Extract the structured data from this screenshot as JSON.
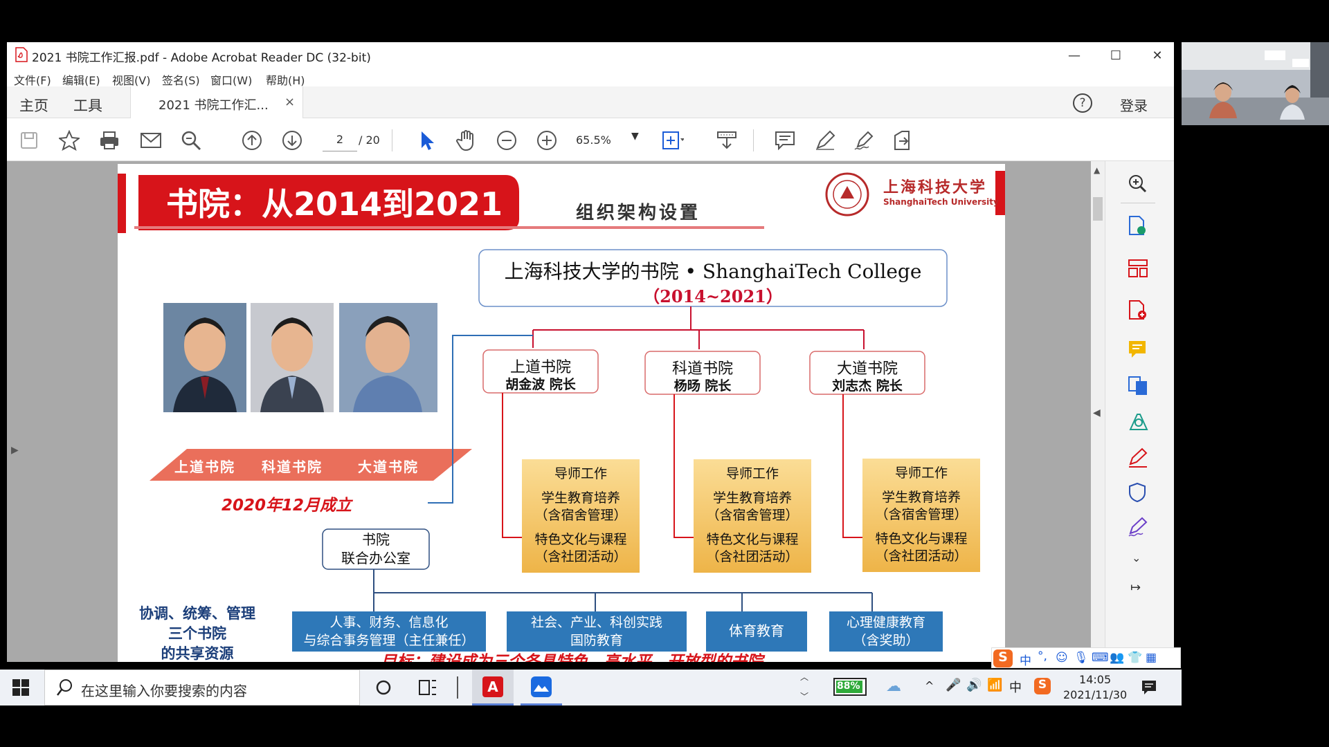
{
  "window": {
    "title": "2021 书院工作汇报.pdf - Adobe Acrobat Reader DC (32-bit)",
    "controls": {
      "minimize": "—",
      "maximize": "☐",
      "close": "✕"
    }
  },
  "menu": [
    "文件(F)",
    "编辑(E)",
    "视图(V)",
    "签名(S)",
    "窗口(W)",
    "帮助(H)"
  ],
  "tabs": {
    "home": "主页",
    "tools": "工具",
    "document": "2021 书院工作汇...",
    "close": "×",
    "signin": "登录",
    "help": "?"
  },
  "toolbar": {
    "page_current": "2",
    "page_total": "/ 20",
    "zoom": "65.5%"
  },
  "slide": {
    "banner": "书院：从2014到2021",
    "subtitle": "组织架构设置",
    "logo_cn": "上海科技大学",
    "logo_en": "ShanghaiTech University",
    "top_box_line1": "上海科技大学的书院 • ShanghaiTech College",
    "top_box_line2": "（2014~2021）",
    "photo_labels": [
      "上道书院",
      "科道书院",
      "大道书院"
    ],
    "founded": "2020年12月成立",
    "colleges": [
      {
        "name": "上道书院",
        "head": "胡金波  院长"
      },
      {
        "name": "科道书院",
        "head": "杨旸  院长"
      },
      {
        "name": "大道书院",
        "head": "刘志杰  院长"
      }
    ],
    "duties": {
      "line1": "导师工作",
      "line2": "学生教育培养",
      "line3": "（含宿舍管理）",
      "line4": "特色文化与课程",
      "line5": "（含社团活动）"
    },
    "office": {
      "line1": "书院",
      "line2": "联合办公室"
    },
    "coordination": {
      "line1": "协调、统筹、管理",
      "line2": "三个书院",
      "line3": "的共享资源"
    },
    "resources": [
      {
        "line1": "人事、财务、信息化",
        "line2": "与综合事务管理（主任兼任）"
      },
      {
        "line1": "社会、产业、科创实践",
        "line2": "国防教育"
      },
      {
        "line1": "体育教育",
        "line2": ""
      },
      {
        "line1": "心理健康教育",
        "line2": "（含奖助）"
      }
    ],
    "goal": "目标：建设成为三个各具特色、高水平、开放型的书院"
  },
  "taskbar": {
    "search_placeholder": "在这里输入你要搜索的内容",
    "battery": "88%",
    "time": "14:05",
    "date": "2021/11/30",
    "ime_cn": "中"
  },
  "colors": {
    "accent_red": "#d7141a",
    "gold": "#f3c25c",
    "blue_box": "#2e78b8"
  }
}
